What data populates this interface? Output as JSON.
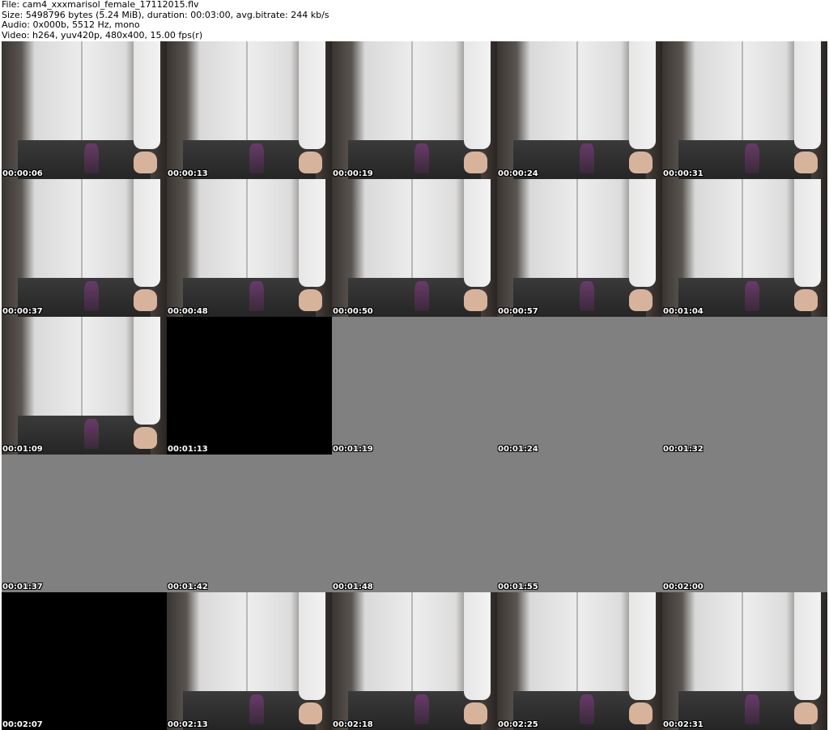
{
  "header": {
    "file_line": "File: cam4_xxxmarisol_female_17112015.flv",
    "size_line": "Size: 5498796 bytes (5.24 MiB), duration: 00:03:00, avg.bitrate: 244 kb/s",
    "audio_line": "Audio: 0x000b, 5512 Hz, mono",
    "video_line": "Video: h264, yuv420p, 480x400, 15.00 fps(r)"
  },
  "thumbnails": [
    {
      "time": "00:00:06",
      "kind": "photo"
    },
    {
      "time": "00:00:13",
      "kind": "photo"
    },
    {
      "time": "00:00:19",
      "kind": "photo"
    },
    {
      "time": "00:00:24",
      "kind": "photo"
    },
    {
      "time": "00:00:31",
      "kind": "photo"
    },
    {
      "time": "00:00:37",
      "kind": "photo"
    },
    {
      "time": "00:00:48",
      "kind": "photo"
    },
    {
      "time": "00:00:50",
      "kind": "photo"
    },
    {
      "time": "00:00:57",
      "kind": "photo"
    },
    {
      "time": "00:01:04",
      "kind": "photo"
    },
    {
      "time": "00:01:09",
      "kind": "photo"
    },
    {
      "time": "00:01:13",
      "kind": "black"
    },
    {
      "time": "00:01:19",
      "kind": "gray"
    },
    {
      "time": "00:01:24",
      "kind": "gray"
    },
    {
      "time": "00:01:32",
      "kind": "gray"
    },
    {
      "time": "00:01:37",
      "kind": "gray"
    },
    {
      "time": "00:01:42",
      "kind": "gray"
    },
    {
      "time": "00:01:48",
      "kind": "gray"
    },
    {
      "time": "00:01:55",
      "kind": "gray"
    },
    {
      "time": "00:02:00",
      "kind": "gray"
    },
    {
      "time": "00:02:07",
      "kind": "black"
    },
    {
      "time": "00:02:13",
      "kind": "photo"
    },
    {
      "time": "00:02:18",
      "kind": "photo"
    },
    {
      "time": "00:02:25",
      "kind": "photo"
    },
    {
      "time": "00:02:31",
      "kind": "photo"
    }
  ]
}
